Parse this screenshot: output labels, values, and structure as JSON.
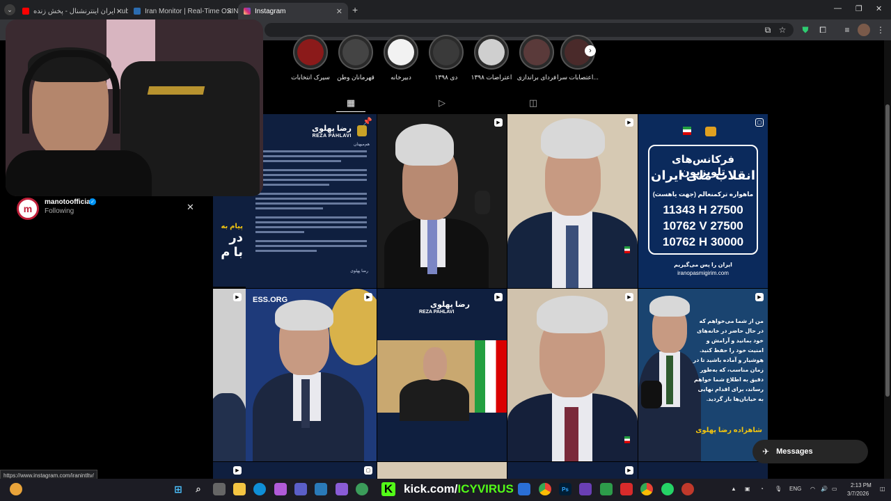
{
  "browser": {
    "tabs": [
      {
        "title": "ایران اینترنشنال - پخش زنده - ube",
        "favicon_color": "#ff0000",
        "active": false
      },
      {
        "title": "Iran Monitor | Real-Time OSINT",
        "favicon_color": "#2b6cb0",
        "active": false
      },
      {
        "title": "Instagram",
        "favicon_color": "#e1306c",
        "active": true
      }
    ],
    "new_tab_icon": "plus-icon",
    "window_controls": [
      "minimize-icon",
      "restore-icon",
      "close-icon"
    ]
  },
  "profile": {
    "account_name": "manotoofficial",
    "verified": true,
    "follow_status": "Following"
  },
  "highlights": [
    {
      "label": "سیرک انتخابات"
    },
    {
      "label": "قهرمانان وطن"
    },
    {
      "label": "دبیرخانه"
    },
    {
      "label": "دی ۱۳۹۸"
    },
    {
      "label": "اعتراضات ۱۳۹۸"
    },
    {
      "label": "فردای براندازی"
    },
    {
      "label": "اعتصابات سرا..."
    }
  ],
  "profile_tabs": [
    "grid-icon",
    "reels-icon",
    "tagged-icon"
  ],
  "posts": {
    "p1_brand_fa": "رضا پهلوی",
    "p1_brand_en": "REZA PAHLAVI",
    "p1_heading": "هم‌میهنان",
    "p1_signoff": "رضا پهلوی",
    "p4_title": "فرکانس‌های تلویزیون",
    "p4_subtitle": "انقلاب ملی ایران",
    "p4_satellite": "ماهواره ترکمنعالم (جهت یاهست)",
    "p4_freqs": [
      "11343 H 27500",
      "10762 V 27500",
      "10762 H 30000"
    ],
    "p4_slogan": "ایران را پس می‌گیریم",
    "p4_site": "iranopasmigirim.com",
    "p5_partial": [
      "پیام به",
      "در",
      "با م"
    ],
    "p6_banner": "ESS.ORG",
    "p7_brand_fa": "رضا پهلوی",
    "p7_brand_en": "REZA PAHLAVI",
    "p9_quote": "من از شما می‌خواهم که در حال حاضر در خانه‌های خود بمانید و آرامش و امنیت خود را حفظ کنید. هوشیار و آماده باشید تا در زمان مناسب، که به‌طور دقیق به اطلاع شما خواهم رساند، برای اقدام نهایی به خیابان‌ها باز گردید.",
    "p9_signature": "شاهزاده رضا پهلوی"
  },
  "messages_button": "Messages",
  "status_url": "https://www.instagram.com/iranintltv/",
  "taskbar": {
    "kick_prefix": "kick.com/",
    "kick_channel": "ICYVIRUS",
    "lang": "ENG",
    "time": "2:13 PM",
    "date": "3/7/2026"
  },
  "colors": {
    "instagram_accent": "#e1306c",
    "kick_green": "#53fc18",
    "post_navy": "#0f1f3f",
    "verified_blue": "#0095f6"
  }
}
